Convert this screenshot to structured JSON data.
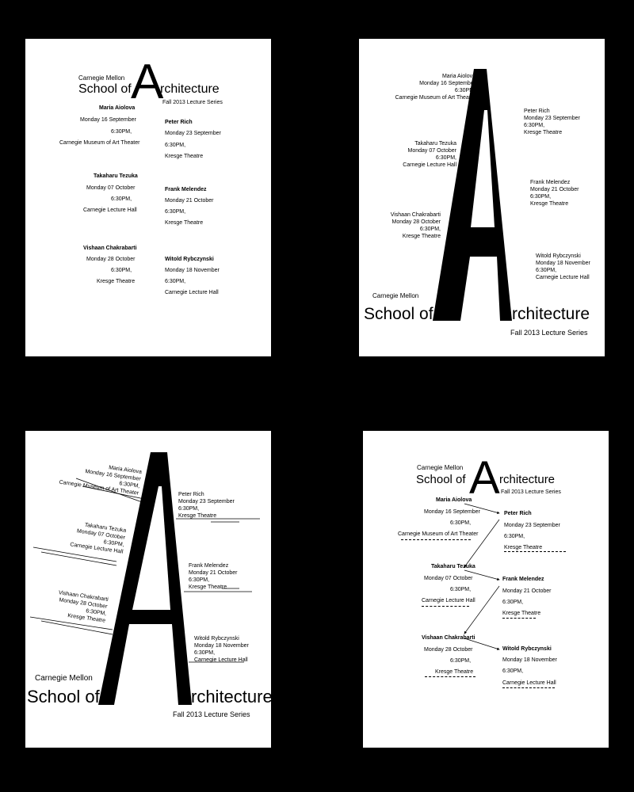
{
  "brand": {
    "university": "Carnegie Mellon",
    "school_prefix": "School of",
    "big_letter": "A",
    "school_suffix": "rchitecture",
    "series": "Fall 2013 Lecture Series"
  },
  "common": {
    "time": "6:30PM,"
  },
  "lectures": [
    {
      "name": "Maria Aiolova",
      "date": "Monday 16 September",
      "venue": "Carnegie Museum of Art Theater"
    },
    {
      "name": "Peter Rich",
      "date": "Monday 23 September",
      "venue": "Kresge Theatre"
    },
    {
      "name": "Takaharu Tezuka",
      "date": "Monday 07 October",
      "venue": "Carnegie Lecture Hall"
    },
    {
      "name": "Frank Melendez",
      "date": "Monday 21 October",
      "venue": "Kresge Theatre"
    },
    {
      "name": "Vishaan Chakrabarti",
      "date": "Monday 28 October",
      "venue": "Kresge Theatre"
    },
    {
      "name": "Witold Rybczynski",
      "date": "Monday 18 November",
      "venue": "Carnegie Lecture Hall"
    }
  ]
}
